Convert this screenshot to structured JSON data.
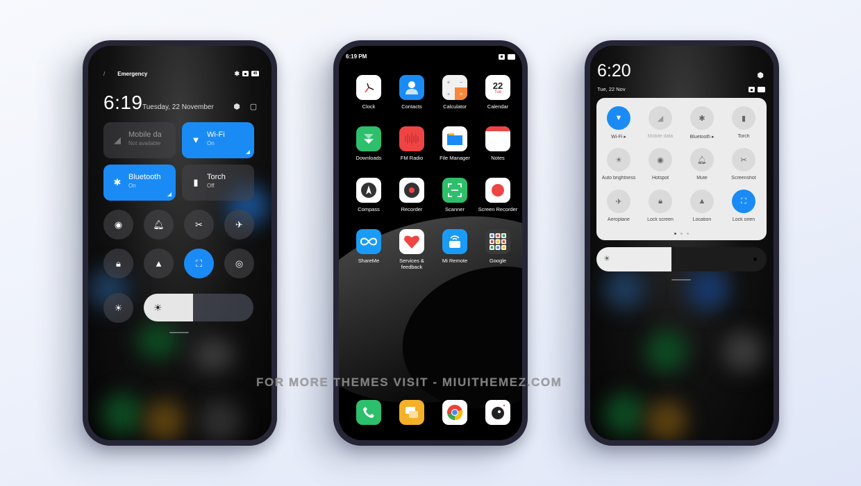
{
  "watermark": "FOR MORE THEMES VISIT - MIUITHEMEZ.COM",
  "colors": {
    "accent": "#1a8bf5",
    "background": "#eef2fb",
    "frame": "#262637"
  },
  "phone1": {
    "status": {
      "left_glyph": "/",
      "carrier": "Emergency",
      "icons": [
        "bluetooth-icon",
        "sim-icon",
        "battery-icon"
      ],
      "battery": "45"
    },
    "time": "6:19",
    "date": "Tuesday, 22 November",
    "header_icons": [
      "settings-hex-icon",
      "edit-icon"
    ],
    "tiles": [
      {
        "title": "Mobile da",
        "sub": "Not available",
        "state": "off",
        "icon": "signal-icon"
      },
      {
        "title": "Wi-Fi",
        "sub": "On",
        "state": "on",
        "icon": "wifi-icon"
      },
      {
        "title": "Bluetooth",
        "sub": "On",
        "state": "on",
        "icon": "bluetooth-icon"
      },
      {
        "title": "Torch",
        "sub": "Off",
        "state": "neutral",
        "icon": "torch-icon"
      }
    ],
    "toggles": [
      {
        "icon": "hotspot-icon",
        "glyph": "◉",
        "on": false
      },
      {
        "icon": "bell-icon",
        "glyph": "🔔︎",
        "on": false
      },
      {
        "icon": "scissors-icon",
        "glyph": "✂",
        "on": false
      },
      {
        "icon": "airplane-icon",
        "glyph": "✈",
        "on": false
      },
      {
        "icon": "lock-icon",
        "glyph": "🔒︎",
        "on": false
      },
      {
        "icon": "location-icon",
        "glyph": "▲",
        "on": false
      },
      {
        "icon": "rotation-lock-icon",
        "glyph": "⛶",
        "on": true
      },
      {
        "icon": "record-icon",
        "glyph": "◎",
        "on": false
      }
    ],
    "auto_brightness_glyph": "☀",
    "brightness_glyph": "☀",
    "brightness_level": 0.45
  },
  "phone2": {
    "status_time": "6:19 PM",
    "apps": [
      {
        "label": "Clock",
        "icon": "clock-icon"
      },
      {
        "label": "Contacts",
        "icon": "contacts-icon"
      },
      {
        "label": "Calculator",
        "icon": "calculator-icon"
      },
      {
        "label": "Calendar",
        "icon": "calendar-icon",
        "day": "22",
        "weekday": "Tue"
      },
      {
        "label": "Downloads",
        "icon": "downloads-icon"
      },
      {
        "label": "FM Radio",
        "icon": "fm-radio-icon"
      },
      {
        "label": "File Manager",
        "icon": "file-manager-icon"
      },
      {
        "label": "Notes",
        "icon": "notes-icon"
      },
      {
        "label": "Compass",
        "icon": "compass-icon"
      },
      {
        "label": "Recorder",
        "icon": "recorder-icon"
      },
      {
        "label": "Scanner",
        "icon": "scanner-icon"
      },
      {
        "label": "Screen Recorder",
        "icon": "screen-recorder-icon"
      },
      {
        "label": "ShareMe",
        "icon": "shareme-icon"
      },
      {
        "label": "Services & feedback",
        "icon": "services-feedback-icon"
      },
      {
        "label": "Mi Remote",
        "icon": "mi-remote-icon"
      },
      {
        "label": "Google",
        "icon": "google-folder-icon"
      }
    ],
    "dock": [
      {
        "label": "Phone",
        "icon": "phone-icon"
      },
      {
        "label": "Messages",
        "icon": "messages-icon"
      },
      {
        "label": "Chrome",
        "icon": "chrome-icon"
      },
      {
        "label": "Camera",
        "icon": "camera-icon"
      }
    ]
  },
  "phone3": {
    "time": "6:20",
    "date": "Tue, 22 Nov",
    "tiles": [
      {
        "label": "Wi-Fi ▸",
        "icon": "wifi-icon",
        "glyph": "▼",
        "on": true
      },
      {
        "label": "Mobile data",
        "icon": "signal-icon",
        "glyph": "◢",
        "on": false,
        "dim": true
      },
      {
        "label": "Bluetooth ▸",
        "icon": "bluetooth-icon",
        "glyph": "✱",
        "on": false
      },
      {
        "label": "Torch",
        "icon": "torch-icon",
        "glyph": "▮",
        "on": false
      },
      {
        "label": "Auto brightness",
        "icon": "auto-brightness-icon",
        "glyph": "☀",
        "on": false
      },
      {
        "label": "Hotspot",
        "icon": "hotspot-icon",
        "glyph": "◉",
        "on": false
      },
      {
        "label": "Mute",
        "icon": "bell-icon",
        "glyph": "🔔︎",
        "on": false
      },
      {
        "label": "Screenshot",
        "icon": "scissors-icon",
        "glyph": "✂",
        "on": false
      },
      {
        "label": "Aeroplane",
        "icon": "airplane-icon",
        "glyph": "✈",
        "on": false
      },
      {
        "label": "Lock screen",
        "icon": "lock-icon",
        "glyph": "🔒︎",
        "on": false
      },
      {
        "label": "Location",
        "icon": "location-icon",
        "glyph": "▲",
        "on": false
      },
      {
        "label": "Lock orien",
        "icon": "rotation-lock-icon",
        "glyph": "⛶",
        "on": true
      }
    ],
    "page_count": 3,
    "active_page": 1,
    "brightness_glyph": "☀",
    "brightness_level": 0.44
  }
}
